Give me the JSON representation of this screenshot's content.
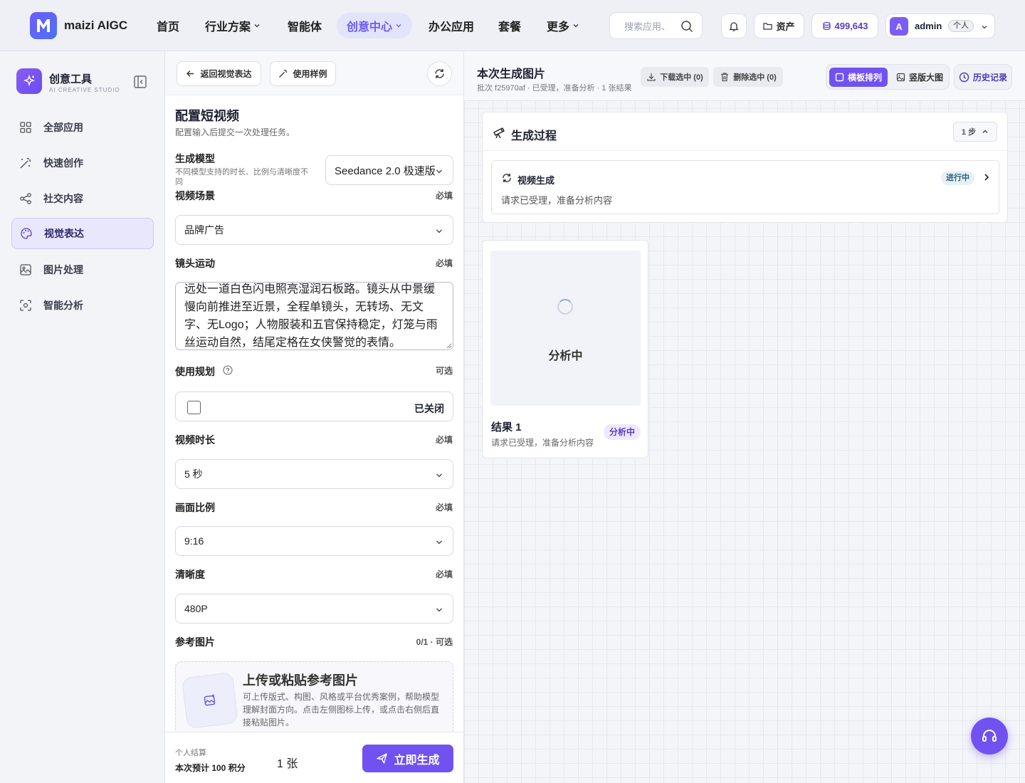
{
  "header": {
    "brand": "maizi AIGC",
    "nav": [
      {
        "label": "首页",
        "dropdown": false
      },
      {
        "label": "行业方案",
        "dropdown": true
      },
      {
        "label": "智能体",
        "dropdown": false
      },
      {
        "label": "创意中心",
        "dropdown": true,
        "active": true
      },
      {
        "label": "办公应用",
        "dropdown": false
      },
      {
        "label": "套餐",
        "dropdown": false
      },
      {
        "label": "更多",
        "dropdown": true
      }
    ],
    "search_placeholder": "搜索应用、",
    "assets_label": "资产",
    "points": "499,643",
    "user": {
      "avatar": "A",
      "name": "admin",
      "badge": "个人"
    }
  },
  "sidebar": {
    "title": "创意工具",
    "subtitle": "AI CREATIVE STUDIO",
    "items": [
      {
        "label": "全部应用",
        "icon": "grid-icon"
      },
      {
        "label": "快速创作",
        "icon": "magic-wand-icon"
      },
      {
        "label": "社交内容",
        "icon": "share-icon"
      },
      {
        "label": "视觉表达",
        "icon": "palette-icon",
        "active": true
      },
      {
        "label": "图片处理",
        "icon": "image-edit-icon"
      },
      {
        "label": "智能分析",
        "icon": "scan-icon"
      }
    ]
  },
  "form": {
    "back_label": "返回视觉表达",
    "sample_label": "使用样例",
    "title": "配置短视频",
    "desc": "配置输入后提交一次处理任务。",
    "model": {
      "label": "生成模型",
      "hint": "不同模型支持的时长、比例与清晰度不同",
      "value": "Seedance 2.0 极速版"
    },
    "scene": {
      "label": "视频场景",
      "req": "必填",
      "value": "品牌广告"
    },
    "camera": {
      "label": "镜头运动",
      "req": "必填",
      "value": "远处一道白色闪电照亮湿润石板路。镜头从中景缓慢向前推进至近景，全程单镜头，无转场、无文字、无Logo；人物服装和五官保持稳定，灯笼与雨丝运动自然，结尾定格在女侠警觉的表情。"
    },
    "plan": {
      "label": "使用规划",
      "req": "可选",
      "state": "已关闭"
    },
    "duration": {
      "label": "视频时长",
      "req": "必填",
      "value": "5 秒"
    },
    "ratio": {
      "label": "画面比例",
      "req": "必填",
      "value": "9:16"
    },
    "resolution": {
      "label": "清晰度",
      "req": "必填",
      "value": "480P"
    },
    "reference": {
      "label": "参考图片",
      "req": "0/1 · 可选",
      "upload_title": "上传或粘贴参考图片",
      "upload_desc": "可上传版式、构图、风格或平台优秀案例，帮助模型理解封面方向。点击左侧图标上传，或点击右侧后直接粘贴图片。"
    },
    "footer": {
      "billing": "个人结算",
      "estimate": "本次预计 100 积分",
      "count": "1 张",
      "submit": "立即生成"
    }
  },
  "results": {
    "title": "本次生成图片",
    "subtitle": "批次 f25970af · 已受理，准备分析 · 1 张结果",
    "download_label": "下载选中 (0)",
    "delete_label": "删除选中 (0)",
    "view_grid": "横板排列",
    "view_large": "竖版大图",
    "history": "历史记录",
    "process": {
      "title": "生成过程",
      "steps": "1 步",
      "step": {
        "title": "视频生成",
        "status": "进行中",
        "desc": "请求已受理，准备分析内容"
      }
    },
    "card": {
      "preview_text": "分析中",
      "title": "结果 1",
      "desc": "请求已受理，准备分析内容",
      "status": "分析中"
    }
  },
  "colors": {
    "accent": "#7152f0",
    "nav_active": "#6d5cf6"
  }
}
